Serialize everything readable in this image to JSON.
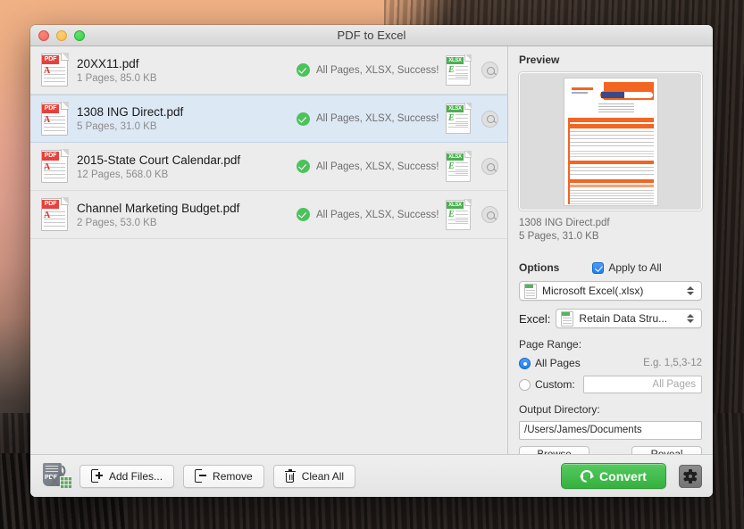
{
  "window": {
    "title": "PDF to Excel",
    "traffic_lights": [
      "close-red",
      "minimize-yellow",
      "zoom-green"
    ]
  },
  "file_list": [
    {
      "name": "20XX11.pdf",
      "sub": "1 Pages, 85.0 KB",
      "status": "All Pages, XLSX, Success!",
      "selected": false,
      "file_icon": "pdf-file-icon",
      "badge": "PDF",
      "out_icon": "xlsx-file-icon",
      "out_badge": "XLSX"
    },
    {
      "name": "1308 ING Direct.pdf",
      "sub": "5 Pages, 31.0 KB",
      "status": "All Pages, XLSX, Success!",
      "selected": true,
      "file_icon": "pdf-file-icon",
      "badge": "PDF",
      "out_icon": "xlsx-file-icon",
      "out_badge": "XLSX"
    },
    {
      "name": "2015-State Court Calendar.pdf",
      "sub": "12 Pages, 568.0 KB",
      "status": "All Pages, XLSX, Success!",
      "selected": false,
      "file_icon": "pdf-file-icon",
      "badge": "PDF",
      "out_icon": "xlsx-file-icon",
      "out_badge": "XLSX"
    },
    {
      "name": "Channel Marketing Budget.pdf",
      "sub": "2 Pages, 53.0 KB",
      "status": "All Pages, XLSX, Success!",
      "selected": false,
      "file_icon": "pdf-file-icon",
      "badge": "PDF",
      "out_icon": "xlsx-file-icon",
      "out_badge": "XLSX"
    }
  ],
  "preview": {
    "title": "Preview",
    "file_name": "1308 ING Direct.pdf",
    "file_sub": "5 Pages, 31.0 KB",
    "thumbnail_accent": "#f26522"
  },
  "options": {
    "title": "Options",
    "apply_to_all_label": "Apply to All",
    "apply_to_all_checked": true,
    "format_value": "Microsoft Excel(.xlsx)",
    "excel_label": "Excel:",
    "excel_value": "Retain Data Stru...",
    "page_range_title": "Page Range:",
    "all_pages_label": "All Pages",
    "all_pages_selected": true,
    "custom_label": "Custom:",
    "custom_selected": false,
    "custom_placeholder": "All Pages",
    "range_hint": "E.g. 1,5,3-12",
    "output_dir_title": "Output Directory:",
    "output_dir_value": "/Users/James/Documents",
    "browse_label": "Browse",
    "reveal_label": "Reveal"
  },
  "toolbar": {
    "app_logo": "pdf-to-excel-logo",
    "add_files_label": "Add Files...",
    "remove_label": "Remove",
    "clean_all_label": "Clean All",
    "convert_label": "Convert",
    "convert_color": "#3bb847",
    "settings_icon": "gear-icon"
  }
}
